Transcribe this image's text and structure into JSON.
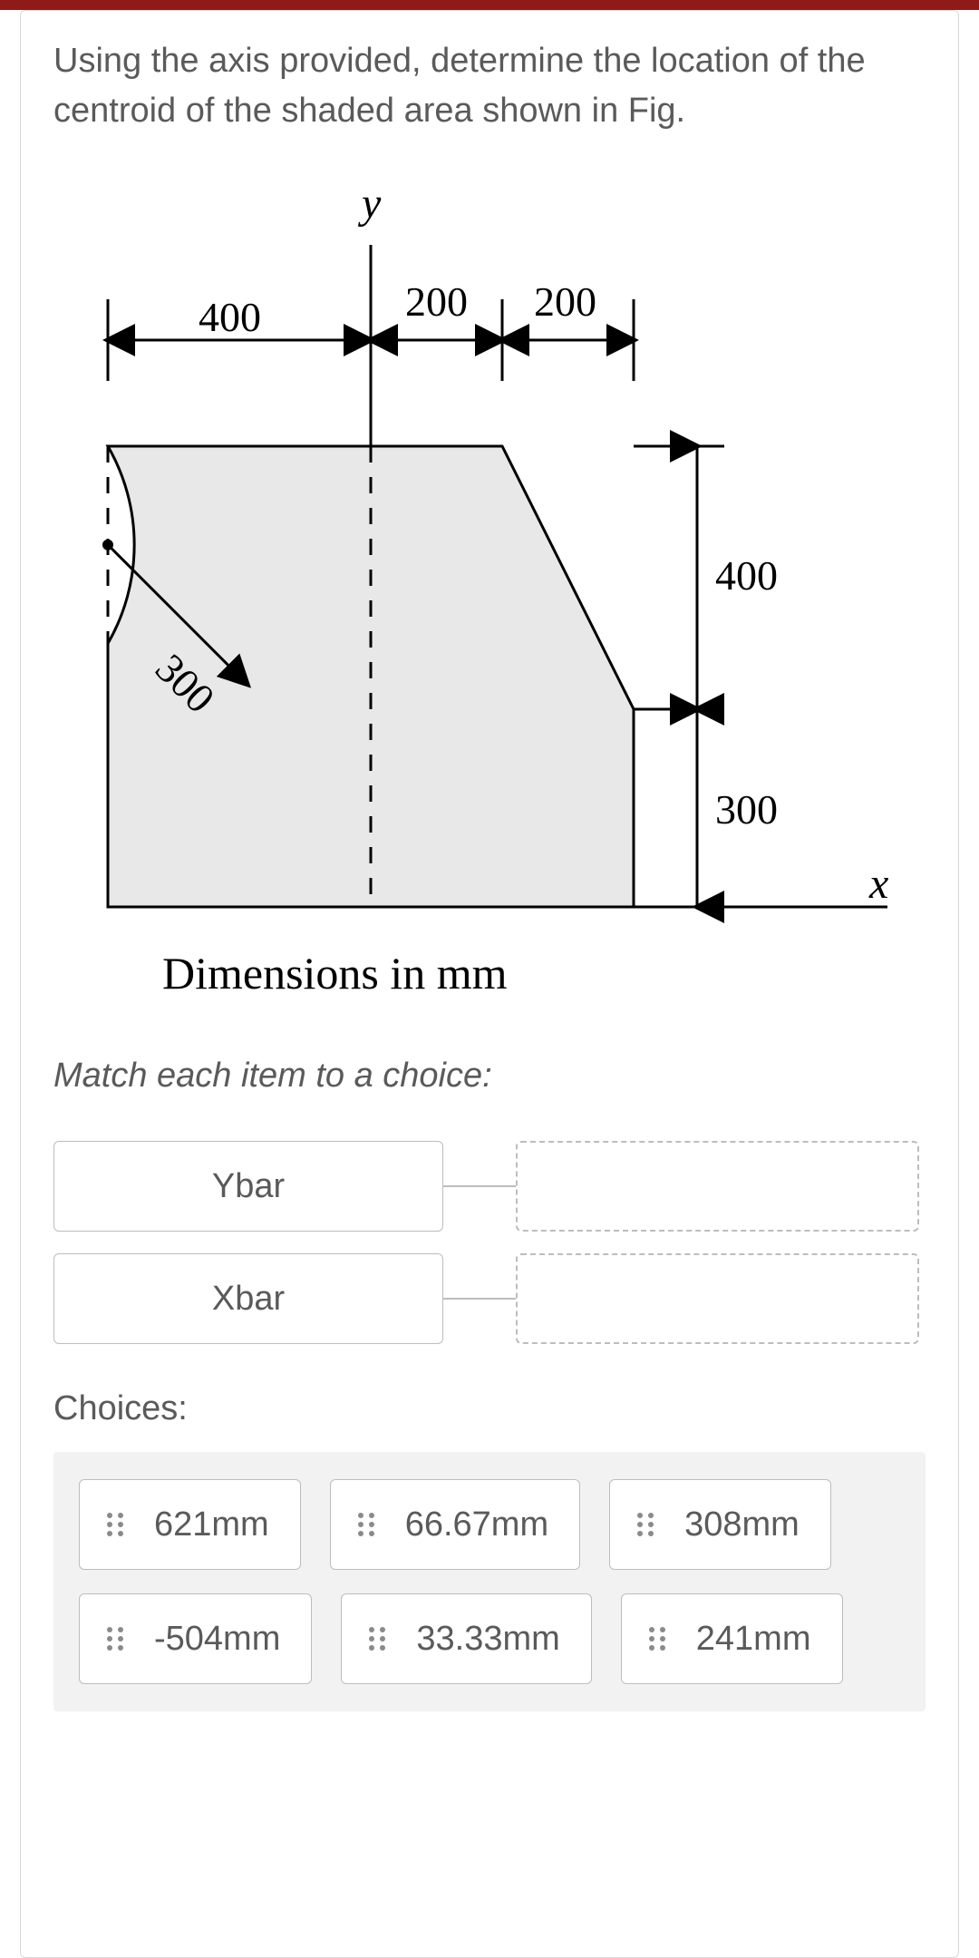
{
  "question_text": "Using the axis provided, determine the location of the centroid of the shaded area shown in Fig.",
  "figure": {
    "y_label": "y",
    "x_label": "x",
    "dim_left": "400",
    "dim_mid1": "200",
    "dim_mid2": "200",
    "dim_right_top": "400",
    "dim_right_bot": "300",
    "radius": "300",
    "caption": "Dimensions in mm"
  },
  "match_prompt": "Match each item to a choice:",
  "match_items": [
    {
      "label": "Ybar"
    },
    {
      "label": "Xbar"
    }
  ],
  "choices_label": "Choices:",
  "choices": [
    {
      "label": "621mm"
    },
    {
      "label": "66.67mm"
    },
    {
      "label": "308mm"
    },
    {
      "label": "-504mm"
    },
    {
      "label": "33.33mm"
    },
    {
      "label": "241mm"
    }
  ]
}
